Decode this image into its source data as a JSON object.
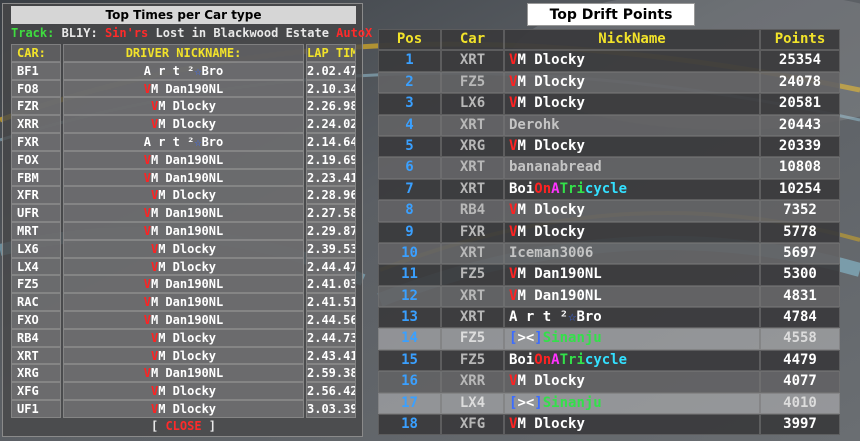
{
  "left": {
    "title": "Top Times per Car type",
    "track_label": "Track:",
    "track_code": " BL1Y: ",
    "track_sins": "Sin'rs",
    "track_name": " Lost in Blackwood Estate ",
    "track_mode": "AutoX",
    "headers": {
      "car": "CAR:",
      "driver": "DRIVER NICKNAME:",
      "lap": "LAP TIME:"
    },
    "rows": [
      {
        "car": "BF1",
        "driver": "artbro",
        "time": "2.02.47"
      },
      {
        "car": "FO8",
        "driver": "dan",
        "time": "2.10.34"
      },
      {
        "car": "FZR",
        "driver": "dlocky",
        "time": "2.26.98"
      },
      {
        "car": "XRR",
        "driver": "dlocky",
        "time": "2.24.02"
      },
      {
        "car": "FXR",
        "driver": "artbro",
        "time": "2.14.64"
      },
      {
        "car": "FOX",
        "driver": "dan",
        "time": "2.19.69"
      },
      {
        "car": "FBM",
        "driver": "dan",
        "time": "2.23.41"
      },
      {
        "car": "XFR",
        "driver": "dlocky",
        "time": "2.28.96"
      },
      {
        "car": "UFR",
        "driver": "dan",
        "time": "2.27.58"
      },
      {
        "car": "MRT",
        "driver": "dan",
        "time": "2.29.87"
      },
      {
        "car": "LX6",
        "driver": "dlocky",
        "time": "2.39.53"
      },
      {
        "car": "LX4",
        "driver": "dlocky",
        "time": "2.44.47"
      },
      {
        "car": "FZ5",
        "driver": "dan",
        "time": "2.41.03"
      },
      {
        "car": "RAC",
        "driver": "dan",
        "time": "2.41.51"
      },
      {
        "car": "FXO",
        "driver": "dan",
        "time": "2.44.56"
      },
      {
        "car": "RB4",
        "driver": "dlocky",
        "time": "2.44.73"
      },
      {
        "car": "XRT",
        "driver": "dlocky",
        "time": "2.43.41"
      },
      {
        "car": "XRG",
        "driver": "dan",
        "time": "2.59.38"
      },
      {
        "car": "XFG",
        "driver": "dlocky",
        "time": "2.56.42"
      },
      {
        "car": "UF1",
        "driver": "dlocky",
        "time": "3.03.39"
      }
    ],
    "close_open": "[ ",
    "close_label": "CLOSE",
    "close_end": " ]"
  },
  "right": {
    "title": "Top Drift Points",
    "headers": {
      "pos": "Pos",
      "car": "Car",
      "nick": "NickName",
      "points": "Points"
    },
    "rows": [
      {
        "pos": "1",
        "car": "XRT",
        "nick": "dlocky",
        "points": "25354"
      },
      {
        "pos": "2",
        "car": "FZ5",
        "nick": "dlocky",
        "points": "24078"
      },
      {
        "pos": "3",
        "car": "LX6",
        "nick": "dlocky",
        "points": "20581"
      },
      {
        "pos": "4",
        "car": "XRT",
        "nick": "derohk",
        "points": "20443"
      },
      {
        "pos": "5",
        "car": "XRG",
        "nick": "dlocky",
        "points": "20339"
      },
      {
        "pos": "6",
        "car": "XRT",
        "nick": "banana",
        "points": "10808"
      },
      {
        "pos": "7",
        "car": "XRT",
        "nick": "boi",
        "points": "10254"
      },
      {
        "pos": "8",
        "car": "RB4",
        "nick": "dlocky",
        "points": "7352"
      },
      {
        "pos": "9",
        "car": "FXR",
        "nick": "dlocky",
        "points": "5778"
      },
      {
        "pos": "10",
        "car": "XRT",
        "nick": "iceman",
        "points": "5697"
      },
      {
        "pos": "11",
        "car": "FZ5",
        "nick": "dan",
        "points": "5300"
      },
      {
        "pos": "12",
        "car": "XRT",
        "nick": "dan",
        "points": "4831"
      },
      {
        "pos": "13",
        "car": "XRT",
        "nick": "artbro",
        "points": "4784"
      },
      {
        "pos": "14",
        "car": "FZ5",
        "nick": "sinanju",
        "points": "4558"
      },
      {
        "pos": "15",
        "car": "FZ5",
        "nick": "boi",
        "points": "4479"
      },
      {
        "pos": "16",
        "car": "XRR",
        "nick": "dlocky",
        "points": "4077"
      },
      {
        "pos": "17",
        "car": "LX4",
        "nick": "sinanju",
        "points": "4010"
      },
      {
        "pos": "18",
        "car": "XFG",
        "nick": "dlocky",
        "points": "3997"
      }
    ]
  },
  "nicknames": {
    "dlocky": [
      {
        "t": "V",
        "c": "red"
      },
      {
        "t": "M Dlocky",
        "c": "white"
      }
    ],
    "dan": [
      {
        "t": "V",
        "c": "red"
      },
      {
        "t": "M Dan190NL",
        "c": "white"
      }
    ],
    "artbro": [
      {
        "t": "A r t ²",
        "c": "white"
      },
      {
        "t": "☆",
        "c": "blue"
      },
      {
        "t": "Bro",
        "c": "white"
      }
    ],
    "derohk": [
      {
        "t": "Derohk",
        "c": "grey"
      }
    ],
    "banana": [
      {
        "t": "bananabread",
        "c": "grey"
      }
    ],
    "iceman": [
      {
        "t": "Iceman3006",
        "c": "grey"
      }
    ],
    "boi": [
      {
        "t": "Boi",
        "c": "white"
      },
      {
        "t": "On",
        "c": "red"
      },
      {
        "t": "A",
        "c": "mag"
      },
      {
        "t": "Tri",
        "c": "grn"
      },
      {
        "t": "cycle",
        "c": "cyan"
      }
    ],
    "sinanju": [
      {
        "t": "[",
        "c": "blue"
      },
      {
        "t": "><",
        "c": "white"
      },
      {
        "t": "]",
        "c": "blue"
      },
      {
        "t": "Sinanju",
        "c": "grn"
      }
    ]
  },
  "colors": {
    "white": "#ffffff",
    "grey": "#c4c4c4",
    "red": "#ff2222",
    "blue": "#3b6cff",
    "cyan": "#33e0ff",
    "mag": "#ff33ff",
    "grn": "#33e04a",
    "header_yellow": "#f2e32a",
    "pos_blue": "#3aa0ff"
  }
}
